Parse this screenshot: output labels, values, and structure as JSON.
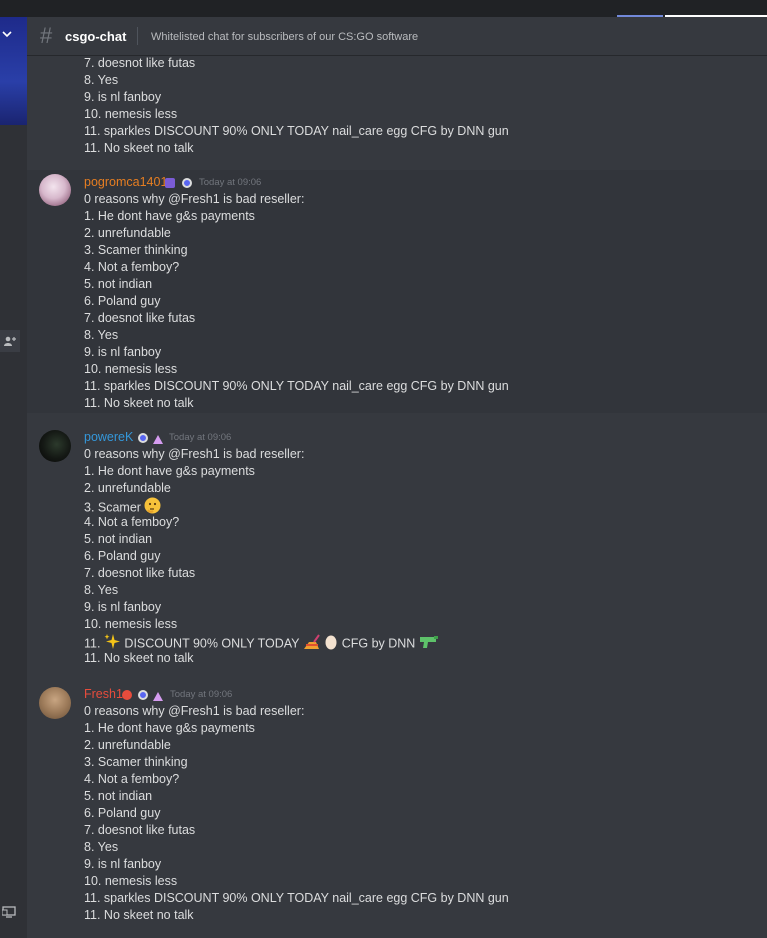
{
  "channel": {
    "name": "csgo-chat",
    "topic": "Whitelisted chat for subscribers of our CS:GO software"
  },
  "colors": {
    "pogromca": "#e67e22",
    "powerek": "#3498db",
    "fresh": "#e74c3c"
  },
  "partial": {
    "lines": [
      "7. doesnot like futas",
      "8. Yes",
      "9. is nl fanboy",
      "10. nemesis less",
      "11. sparkles DISCOUNT 90% ONLY TODAY nail_care  egg CFG by DNN gun",
      "11. No skeet no talk"
    ]
  },
  "messages": [
    {
      "author": "pogromca1401",
      "timestamp": "Today at 09:06",
      "lines": [
        "0 reasons why @Fresh1  is bad reseller:",
        "1. He dont have g&s payments",
        "2. unrefundable",
        "3. Scamer thinking",
        "4. Not a femboy?",
        "5. not indian",
        "6. Poland guy",
        "7. doesnot like futas",
        "8. Yes",
        "9. is nl fanboy",
        "10. nemesis less",
        "11. sparkles DISCOUNT 90% ONLY TODAY nail_care  egg CFG by DNN gun",
        "11. No skeet no talk"
      ]
    },
    {
      "author": "powereK",
      "timestamp": "Today at 09:06",
      "lines": [
        "0 reasons why @Fresh1  is bad reseller:",
        "1. He dont have g&s payments",
        "2. unrefundable",
        "3. Scamer",
        "4. Not a femboy?",
        "5. not indian",
        "6. Poland guy",
        "7. doesnot like futas",
        "8. Yes",
        "9. is nl fanboy",
        "10. nemesis less",
        "11.",
        "DISCOUNT 90% ONLY TODAY",
        "CFG by DNN",
        "11. No skeet no talk"
      ]
    },
    {
      "author": "Fresh1",
      "timestamp": "Today at 09:06",
      "lines": [
        "0 reasons why @Fresh1  is bad reseller:",
        "1. He dont have g&s payments",
        "2. unrefundable",
        "3. Scamer thinking",
        "4. Not a femboy?",
        "5. not indian",
        "6. Poland guy",
        "7. doesnot like futas",
        "8. Yes",
        "9. is nl fanboy",
        "10. nemesis less",
        "11. sparkles DISCOUNT 90% ONLY TODAY nail_care  egg CFG by DNN gun",
        "11. No skeet no talk"
      ]
    }
  ]
}
